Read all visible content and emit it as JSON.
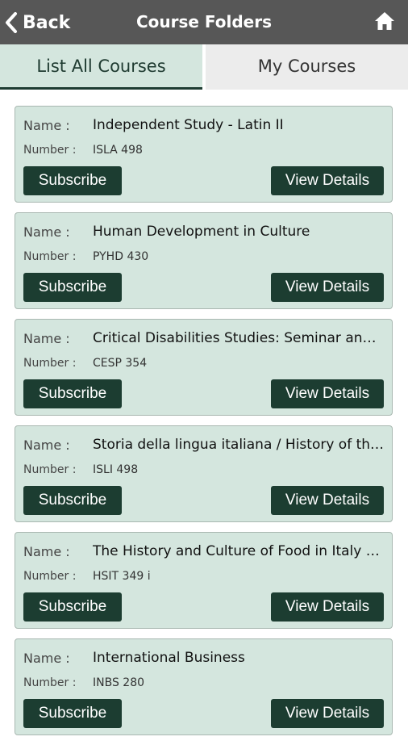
{
  "header": {
    "back_label": "Back",
    "title": "Course Folders"
  },
  "tabs": [
    {
      "label": "List All Courses"
    },
    {
      "label": "My Courses"
    }
  ],
  "labels": {
    "name": "Name :",
    "number": "Number :"
  },
  "buttons": {
    "subscribe": "Subscribe",
    "view_details": "View Details"
  },
  "courses": [
    {
      "name": "Independent Study - Latin II",
      "number": "ISLA 498"
    },
    {
      "name": "Human Development in Culture",
      "number": "PYHD 430"
    },
    {
      "name": "Critical Disabilities Studies: Seminar and…",
      "number": "CESP 354"
    },
    {
      "name": "Storia della lingua italiana / History of th…",
      "number": "ISLI 498"
    },
    {
      "name": "The History and Culture of Food in Italy (…",
      "number": "HSIT 349 i"
    },
    {
      "name": "International Business",
      "number": "INBS 280"
    }
  ],
  "icons": {
    "back": "chevron-left-icon",
    "home": "home-icon"
  },
  "colors": {
    "header": "#575757",
    "card": "#d4e6de",
    "button": "#1c3d31"
  }
}
